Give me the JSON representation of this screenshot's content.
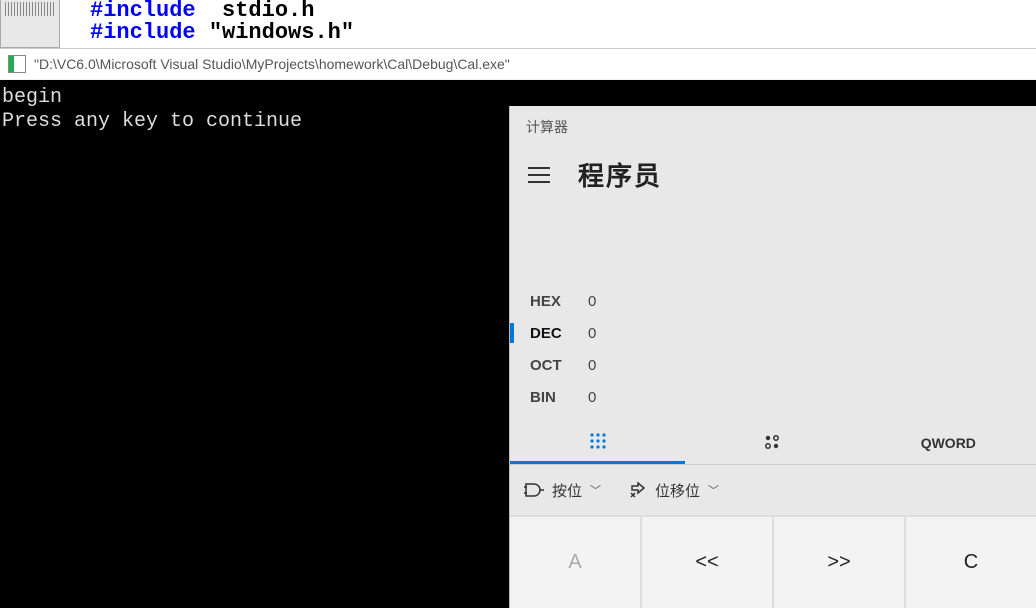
{
  "ide": {
    "code_line1_pre": "#include  ",
    "code_line1_post": "stdio.h",
    "code_line2_pre": "#include ",
    "code_line2_post": "\"windows.h\""
  },
  "console": {
    "title": "\"D:\\VC6.0\\Microsoft Visual Studio\\MyProjects\\homework\\Cal\\Debug\\Cal.exe\"",
    "output_line1": "begin",
    "output_line2": "Press any key to continue"
  },
  "calculator": {
    "app_title": "计算器",
    "mode_title": "程序员",
    "bases": [
      {
        "label": "HEX",
        "value": "0",
        "active": false
      },
      {
        "label": "DEC",
        "value": "0",
        "active": true
      },
      {
        "label": "OCT",
        "value": "0",
        "active": false
      },
      {
        "label": "BIN",
        "value": "0",
        "active": false
      }
    ],
    "qword_label": "QWORD",
    "bitwise_label": "按位",
    "bitshift_label": "位移位",
    "key_a": "A",
    "key_lshift": "<<",
    "key_rshift": ">>",
    "key_c": "C"
  }
}
